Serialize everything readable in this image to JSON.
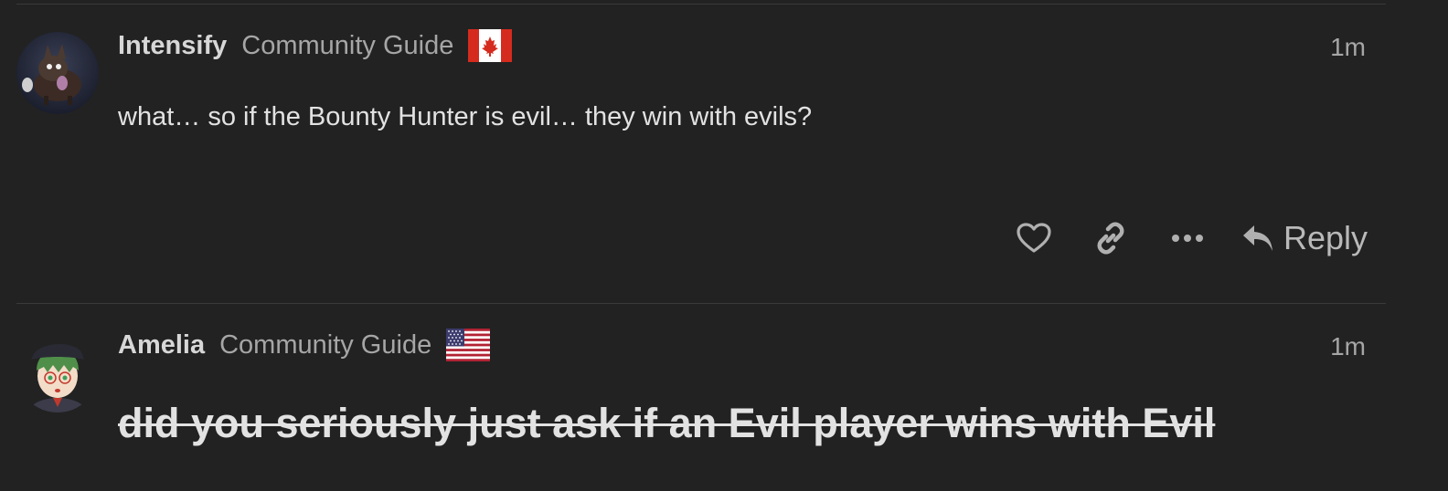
{
  "posts": [
    {
      "username": "Intensify",
      "user_title": "Community Guide",
      "flag": "canada-flag",
      "timestamp": "1m",
      "body": "what… so if the Bounty Hunter is evil… they win with evils?",
      "body_style": "normal",
      "actions": {
        "like_icon": "heart-icon",
        "link_icon": "link-icon",
        "more_icon": "more-icon",
        "reply_icon": "reply-arrow-icon",
        "reply_label": "Reply"
      }
    },
    {
      "username": "Amelia",
      "user_title": "Community Guide",
      "flag": "usa-flag",
      "timestamp": "1m",
      "body": "did you seriously just ask if an Evil player wins with Evil",
      "body_style": "strikethrough-bold-large"
    }
  ],
  "colors": {
    "background": "#222222",
    "divider": "#3a3a3a",
    "username": "#d7d7d7",
    "muted": "#a6a6a6",
    "body": "#e2e2e2",
    "icon": "#b0b0b0",
    "canada_red": "#d52b1e",
    "usa_red": "#b22234",
    "usa_blue": "#3c3b6e"
  }
}
